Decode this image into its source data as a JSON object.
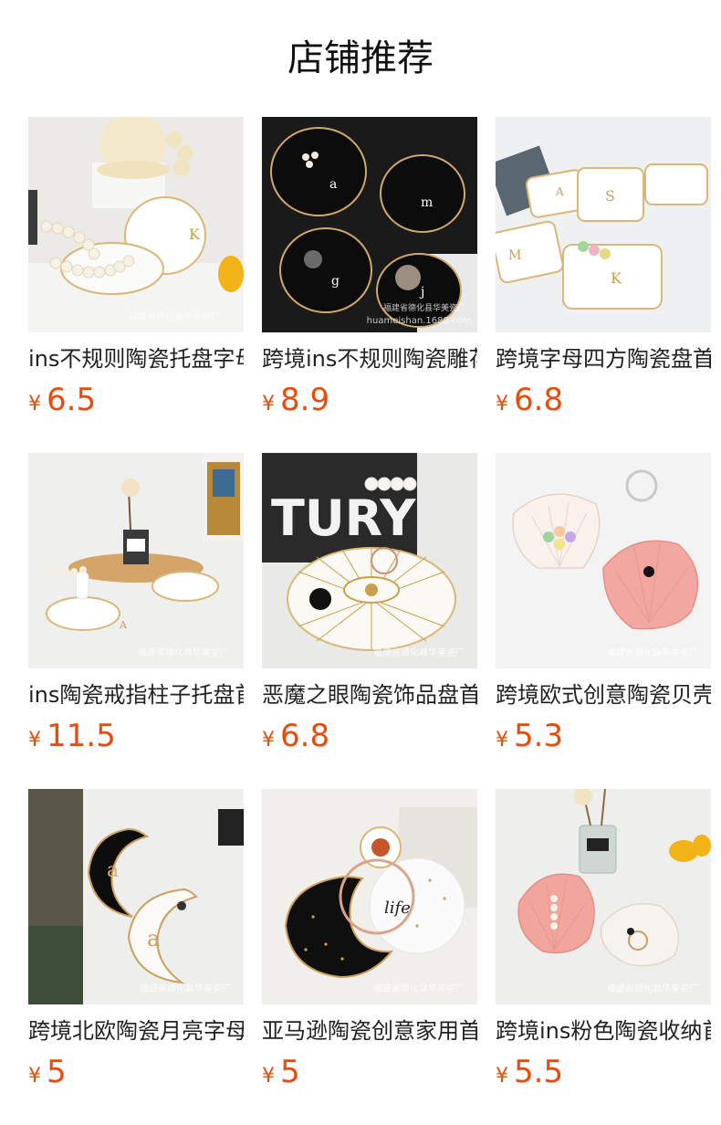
{
  "section_title": "店铺推荐",
  "products": [
    {
      "name": "ins不规则陶瓷托盘字母首饰盘",
      "currency": "¥",
      "price": "6.5",
      "watermark": "福建省德化县华美瓷厂",
      "letters": [
        "K"
      ]
    },
    {
      "name": "跨境ins不规则陶瓷雕花首饰盘",
      "currency": "¥",
      "price": "8.9",
      "watermark": "福建省德化县华美瓷厂",
      "watermark2": "huameishan.1688.com",
      "letters": [
        "a",
        "m",
        "g",
        "j"
      ]
    },
    {
      "name": "跨境字母四方陶瓷盘首饰托盘",
      "currency": "¥",
      "price": "6.8",
      "watermark": "",
      "letters": [
        "A",
        "S",
        "M",
        "K"
      ]
    },
    {
      "name": "ins陶瓷戒指柱子托盘首饰盘",
      "currency": "¥",
      "price": "11.5",
      "watermark": "福建省德化县华美瓷厂",
      "letters": [
        "A"
      ]
    },
    {
      "name": "恶魔之眼陶瓷饰品盘首饰托盘",
      "currency": "¥",
      "price": "6.8",
      "watermark": "福建省德化县华美瓷厂",
      "letters": [
        "TURY"
      ]
    },
    {
      "name": "跨境欧式创意陶瓷贝壳首饰盘",
      "currency": "¥",
      "price": "5.3",
      "watermark": "福建省德化县华美瓷厂",
      "letters": []
    },
    {
      "name": "跨境北欧陶瓷月亮字母首饰盘",
      "currency": "¥",
      "price": "5",
      "watermark": "福建省德化县华美瓷厂",
      "letters": [
        "a",
        "a"
      ]
    },
    {
      "name": "亚马逊陶瓷创意家用首饰收纳盘",
      "currency": "¥",
      "price": "5",
      "watermark": "福建省德化县华美瓷厂",
      "letters": [
        "life"
      ]
    },
    {
      "name": "跨境ins粉色陶瓷收纳首饰盘",
      "currency": "¥",
      "price": "5.5",
      "watermark": "福建省德化县华美瓷厂",
      "letters": []
    }
  ]
}
